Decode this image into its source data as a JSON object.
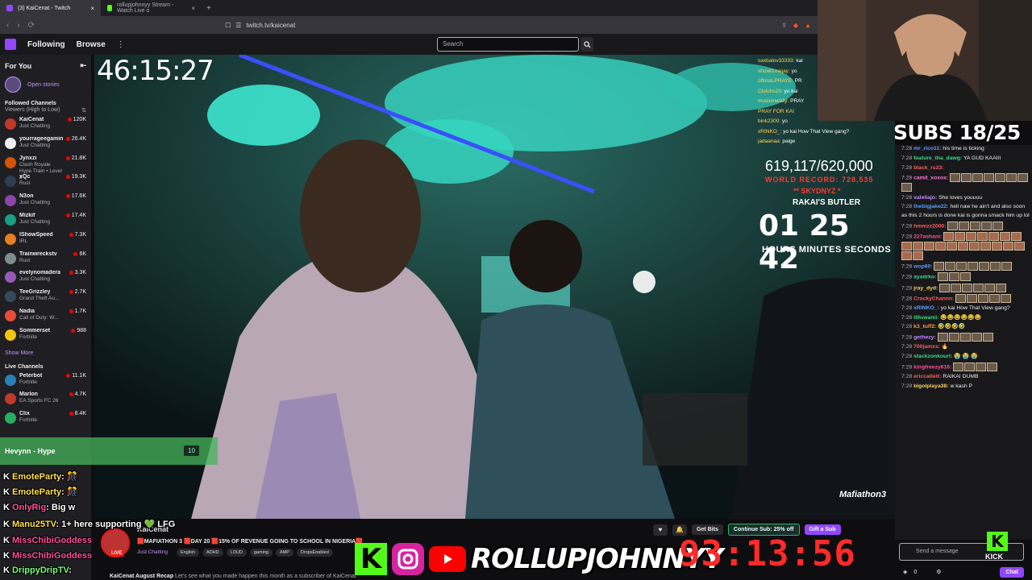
{
  "browser": {
    "tabs": [
      {
        "label": "(3) KaiCenat - Twitch",
        "active": true
      },
      {
        "label": "rollupjohnnyy Stream - Watch Live o",
        "active": false
      }
    ],
    "url": "twitch.tv/kaicenat"
  },
  "topnav": {
    "following": "Following",
    "browse": "Browse",
    "search_placeholder": "Search"
  },
  "sidebar": {
    "for_you": "For You",
    "open_stories": "Open stories",
    "followed_title": "Followed Channels",
    "followed_sort": "Viewers (High to Low)",
    "followed": [
      {
        "name": "KaiCenat",
        "game": "Just Chatting",
        "count": "120K",
        "color": "#c0392b"
      },
      {
        "name": "yourrageegaming",
        "game": "Just Chatting",
        "count": "26.4K",
        "color": "#f0f0f0"
      },
      {
        "name": "Jynxzi",
        "game": "Clash Royale",
        "game2": "Hype Train • Level 2",
        "count": "21.8K",
        "color": "#d35400"
      },
      {
        "name": "xQc",
        "game": "Rust",
        "count": "19.3K",
        "color": "#2c3e50"
      },
      {
        "name": "N3on",
        "game": "Just Chatting",
        "count": "17.6K",
        "color": "#8e44ad"
      },
      {
        "name": "Mizkif",
        "game": "Just Chatting",
        "count": "17.4K",
        "color": "#16a085"
      },
      {
        "name": "IShowSpeed",
        "game": "IRL",
        "count": "7.3K",
        "color": "#e67e22"
      },
      {
        "name": "Trainwreckstv",
        "game": "Rust",
        "count": "6K",
        "color": "#7f8c8d"
      },
      {
        "name": "evelynomadera",
        "game": "Just Chatting",
        "count": "3.3K",
        "color": "#9b59b6"
      },
      {
        "name": "TeeGrizzley",
        "game": "Grand Theft Au...",
        "count": "2.7K",
        "color": "#34495e"
      },
      {
        "name": "Nadia",
        "game": "Call of Duty: W...",
        "count": "1.7K",
        "color": "#e74c3c"
      },
      {
        "name": "Sommerset",
        "game": "Fortnite",
        "count": "988",
        "color": "#f1c40f"
      }
    ],
    "show_more": "Show More",
    "live_title": "Live Channels",
    "live": [
      {
        "name": "Peterbot",
        "game": "Fortnite",
        "count": "11.1K",
        "color": "#2980b9"
      },
      {
        "name": "Marlon",
        "game": "EA Sports FC 26",
        "count": "4.7K",
        "color": "#c0392b"
      },
      {
        "name": "Clix",
        "game": "Fortnite",
        "count": "8.4K",
        "color": "#27ae60"
      }
    ]
  },
  "stream": {
    "uptime": "46:15:27",
    "counter": "619,117/620,000",
    "world_record": "WORLD RECORD: 728,535",
    "sub_to": "** SKYDNYZ *",
    "butler": "RAKAI'S BUTLER",
    "countdown": "01 25 42",
    "countdown_labels": "HOURS  MINUTES SECONDS",
    "video_logo": "Mafiathon3",
    "mini_chat": [
      {
        "user": "saxbalov33333:",
        "text": "kai"
      },
      {
        "user": "showt1mejay:",
        "text": "yo"
      },
      {
        "user": "officiaLPRAYE:",
        "text": "PR"
      },
      {
        "user": "Clutchs20:",
        "text": "yo kai"
      },
      {
        "user": "musicinwally:",
        "text": "PRAY"
      },
      {
        "user": "PRAY FOR KAI",
        "text": ""
      },
      {
        "user": "bink2300:",
        "text": "yo"
      },
      {
        "user": "xRINKO_:",
        "text": "yo kai How That View gang?"
      },
      {
        "user": "",
        "text": ""
      },
      {
        "user": "jadaanaa:",
        "text": "paige"
      }
    ]
  },
  "info": {
    "streamer": "KaiCenat",
    "title": "🟥MAFIATHON 3 🟥DAY 20 🟥15% OF REVENUE GOING TO SCHOOL IN NIGERIA🟥",
    "category": "Just Chatting",
    "tags": [
      "English",
      "ADHD",
      "LOUD",
      "gaming",
      "AMP",
      "DropsEnabled"
    ],
    "live": "LIVE",
    "get_bits": "Get Bits",
    "continue_sub": "Continue Sub: 25% off",
    "gift_sub": "Gift a Sub",
    "recap_title": "KaiCenat August Recap",
    "recap_text": "Let's see what you made happen this month as a subscriber of KaiCenat"
  },
  "cam": {
    "subs": "SUBS 18/25"
  },
  "chat": {
    "messages": [
      {
        "time": "7:28",
        "user": "mr_rico11:",
        "color": "#5b9cff",
        "text": "his time is ticking"
      },
      {
        "time": "7:28",
        "user": "feature_tha_dawg:",
        "color": "#3ddc84",
        "text": "YA GUD KAAIII"
      },
      {
        "time": "7:28",
        "user": "black_rs23:",
        "color": "#ff5c5c",
        "text": ""
      },
      {
        "time": "7:28",
        "user": "camil_xoxox:",
        "color": "#ff7ad9",
        "text": "",
        "emotes": 8
      },
      {
        "time": "7:28",
        "user": "valeliajo:",
        "color": "#c48aff",
        "text": "She loves youuuu"
      },
      {
        "time": "7:28",
        "user": "thebigjake22:",
        "color": "#5b9cff",
        "text": "hell naw he ain't and also soon as this 2 hours is done kai is gonna smack him up lol"
      },
      {
        "time": "7:28",
        "user": "hmmzz2000:",
        "color": "#ff5c5c",
        "text": "",
        "emotes": 5
      },
      {
        "time": "7:28",
        "user": "227ashani:",
        "color": "#ff4f9a",
        "text": "",
        "emotes": 20,
        "red": true
      },
      {
        "time": "7:28",
        "user": "wop60:",
        "color": "#5b9cff",
        "text": "",
        "emotes": 7
      },
      {
        "time": "7:28",
        "user": "ayadrko:",
        "color": "#3ddc84",
        "text": "",
        "emotes": 3
      },
      {
        "time": "7:28",
        "user": "jray_dyd:",
        "color": "#ffd35c",
        "text": "",
        "emotes": 6
      },
      {
        "time": "7:28",
        "user": "CrackyChannn:",
        "color": "#ff5c5c",
        "text": "",
        "emotes": 5
      },
      {
        "time": "7:28",
        "user": "xRINKO_:",
        "color": "#5b9cff",
        "text": "yo kai How That View gang?"
      },
      {
        "time": "7:28",
        "user": "t0luwanii:",
        "color": "#3ddc84",
        "text": "😂😂😂😂😂😂"
      },
      {
        "time": "7:28",
        "user": "k3_tuff2:",
        "color": "#ff9a3d",
        "text": "🤣🤣🤣🤣"
      },
      {
        "time": "7:28",
        "user": "gethezy:",
        "color": "#c48aff",
        "text": "",
        "emotes": 5
      },
      {
        "time": "7:28",
        "user": "700jamxs:",
        "color": "#ff5c5c",
        "text": "🔥"
      },
      {
        "time": "7:28",
        "user": "stackzonkourt:",
        "color": "#3ddc84",
        "text": "😭 😭 😭"
      },
      {
        "time": "7:28",
        "user": "kingfreezy616:",
        "color": "#ff4f9a",
        "text": "",
        "emotes": 4
      },
      {
        "time": "7:28",
        "user": "ericcatlett:",
        "color": "#ff5c5c",
        "text": "RAIKAI DUMB"
      },
      {
        "time": "7:28",
        "user": "bigolplaya38:",
        "color": "#ffd35c",
        "text": "w kash P"
      }
    ],
    "input_placeholder": "Send a message",
    "points": "0",
    "chat_button": "Chat"
  },
  "overlays": {
    "hype_name": "Hevynn - Hype",
    "hype_badge": "10",
    "lines": [
      {
        "name": "EmoteParty",
        "sep": ":",
        "msg": "🎊"
      },
      {
        "name": "EmoteParty",
        "sep": ":",
        "msg": "🎊"
      },
      {
        "name": "OnlyRig",
        "sep": ":",
        "msg": "Big w"
      },
      {
        "name": "Manu25TV",
        "sep": ":",
        "msg": "1+ here supporting 💚 LFG"
      },
      {
        "name": "MissChibiGoddess",
        "sep": "",
        "msg": ""
      },
      {
        "name": "MissChibiGoddess",
        "sep": "",
        "msg": ""
      },
      {
        "name": "DrippyDripTV",
        "sep": ":",
        "msg": ""
      }
    ],
    "promo_handle": "ROLLUPJOHNNYY",
    "big_timer": "93:13:56",
    "kick_text": "KICK"
  }
}
